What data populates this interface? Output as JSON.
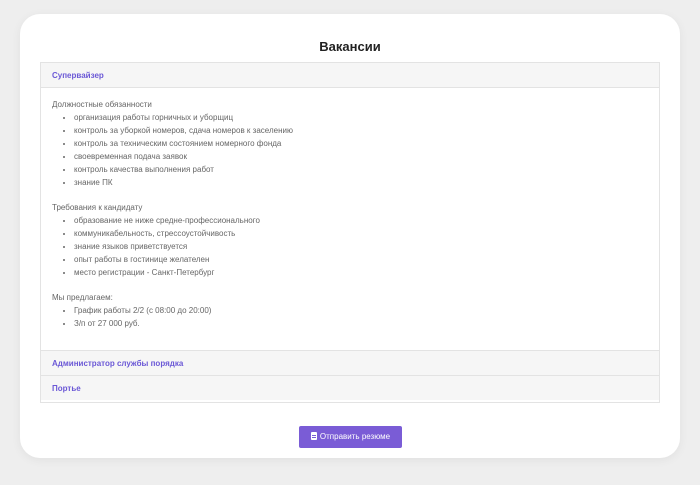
{
  "page": {
    "title": "Вакансии"
  },
  "accordion": {
    "items": [
      {
        "label": "Супервайзер",
        "expanded": true
      },
      {
        "label": "Администратор службы порядка",
        "expanded": false
      },
      {
        "label": "Портье",
        "expanded": false
      }
    ],
    "content": {
      "duties_label": "Должностные обязанности",
      "duties": [
        "организация работы горничных и уборщиц",
        "контроль за уборкой номеров, сдача номеров к заселению",
        "контроль за техническим состоянием номерного фонда",
        "своевременная подача заявок",
        "контроль качества выполнения работ",
        "знание ПК"
      ],
      "requirements_label": "Требования к кандидату",
      "requirements": [
        "образование не ниже средне-профессионального",
        "коммуникабельность, стрессоустойчивость",
        "знание языков приветствуется",
        "опыт работы в гостинице желателен",
        "место регистрации - Санкт-Петербург"
      ],
      "offer_label": "Мы предлагаем:",
      "offer": [
        "График работы 2/2 (с 08:00 до 20:00)",
        "З/п от 27 000 руб."
      ]
    }
  },
  "submit": {
    "label": "Отправить резюме",
    "icon": "document-icon"
  },
  "colors": {
    "accent": "#7a5cd6",
    "link": "#6b58d6",
    "background": "#eeeeee"
  }
}
